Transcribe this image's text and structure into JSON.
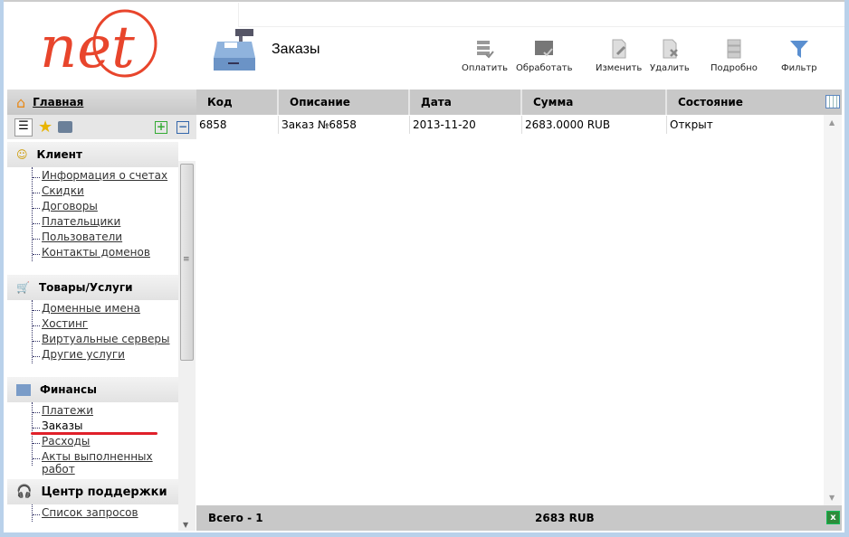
{
  "logo": {
    "text": "net",
    "color": "#e8452c"
  },
  "page": {
    "title": "Заказы"
  },
  "toolbar": [
    {
      "label": "Оплатить",
      "icon": "pay-icon"
    },
    {
      "label": "Обработать",
      "icon": "process-icon"
    },
    {
      "label": "Изменить",
      "icon": "edit-icon"
    },
    {
      "label": "Удалить",
      "icon": "delete-icon"
    },
    {
      "label": "Подробно",
      "icon": "details-icon"
    },
    {
      "label": "Фильтр",
      "icon": "filter-icon"
    }
  ],
  "sidebar": {
    "home": "Главная",
    "sections": [
      {
        "title": "Клиент",
        "items": [
          "Информация о счетах",
          "Скидки",
          "Договоры",
          "Плательщики",
          "Пользователи",
          "Контакты доменов"
        ]
      },
      {
        "title": "Товары/Услуги",
        "items": [
          "Доменные имена",
          "Хостинг",
          "Виртуальные серверы",
          "Другие услуги"
        ]
      },
      {
        "title": "Финансы",
        "items": [
          "Платежи",
          "Заказы",
          "Расходы",
          "Акты выполненных работ"
        ]
      },
      {
        "title": "Центр поддержки",
        "items": [
          "Список запросов"
        ]
      }
    ]
  },
  "table": {
    "columns": [
      "Код",
      "Описание",
      "Дата",
      "Сумма",
      "Состояние"
    ],
    "rows": [
      [
        "6858",
        "Заказ №6858",
        "2013-11-20",
        "2683.0000 RUB",
        "Открыт"
      ]
    ],
    "footer": {
      "total": "Всего - 1",
      "sum": "2683 RUB"
    }
  }
}
